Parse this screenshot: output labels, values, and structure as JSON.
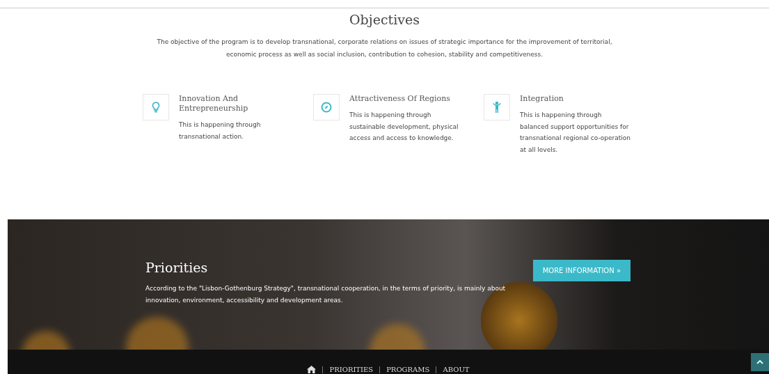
{
  "objectives": {
    "title": "Objectives",
    "intro": "The objective of the program is to develop transnational, corporate relations on issues of strategic importance for the improvement of territorial, economic process as well as social inclusion, contribution to cohesion, stability and competitiveness.",
    "items": [
      {
        "kind": "bulb",
        "title": "Innovation And Entrepreneurship",
        "text": "This is happening through transnational action."
      },
      {
        "kind": "compass",
        "title": "Attractiveness Of Regions",
        "text": "This is happening through sustainable development, physical access and access to knowledge."
      },
      {
        "kind": "person",
        "title": "Integration",
        "text": "This is happening through balanced support opportunities for transnational regional co-operation at all levels."
      }
    ]
  },
  "priorities": {
    "title": "Priorities",
    "text": "According to the \"Lisbon-Gothenburg Strategy\", transnational cooperation, in the terms of priority, is mainly about innovation, environment, accessibility and development areas.",
    "button": "MORE INFORMATION »"
  },
  "footer_nav": [
    "PRIORITIES",
    "PROGRAMS",
    "ABOUT"
  ]
}
